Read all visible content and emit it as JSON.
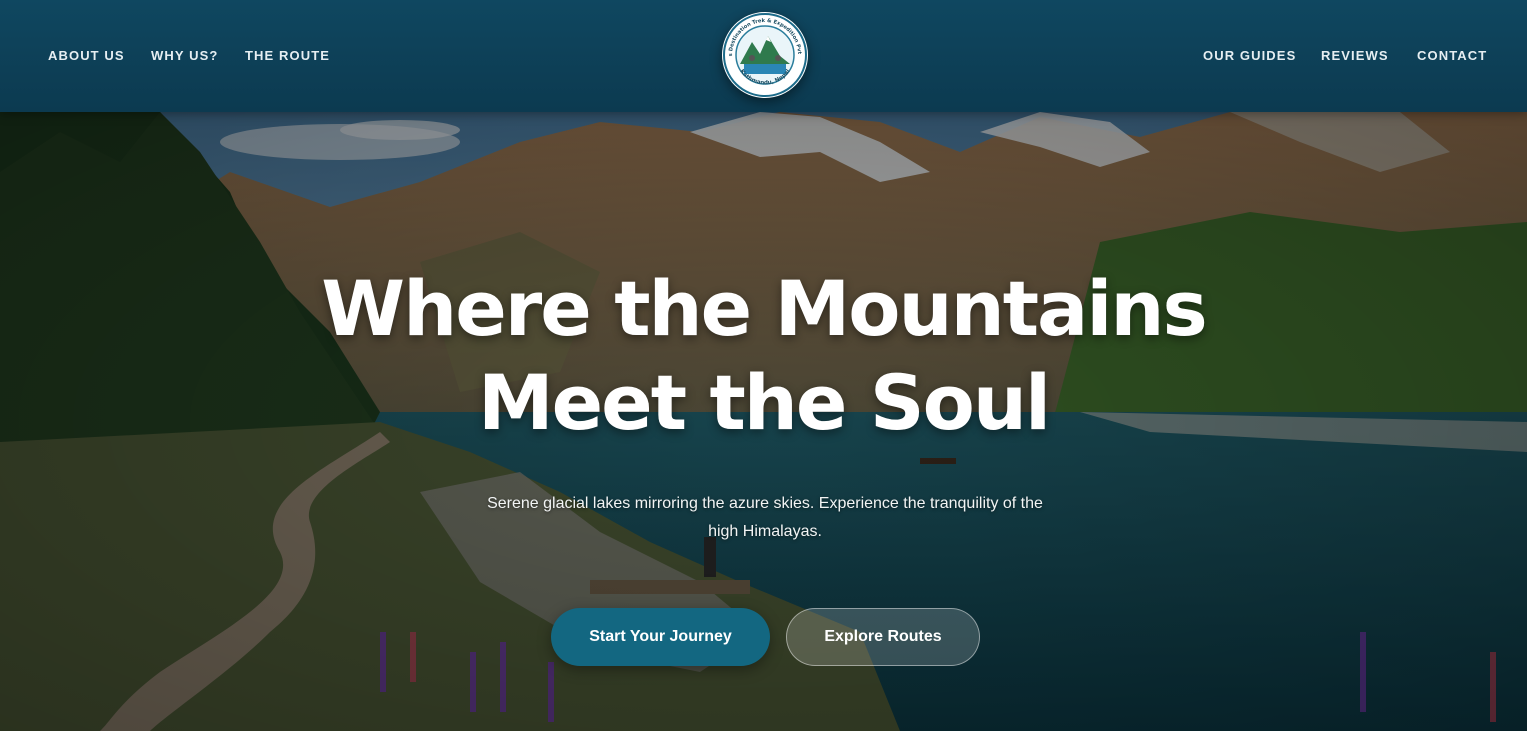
{
  "header": {
    "nav_left": [
      "ABOUT US",
      "WHY US?",
      "THE ROUTE"
    ],
    "nav_right": [
      "OUR GUIDES",
      "REVIEWS",
      "CONTACT"
    ],
    "logo": {
      "top_text": "Lotus Destination Trek & Expedition Pvt. Ltd.",
      "bottom_text": "Kathmandu, Nepal"
    }
  },
  "hero": {
    "title_line1": "Where the Mountains",
    "title_line2": "Meet the Soul",
    "subtitle": "Serene glacial lakes mirroring the azure skies. Experience the tranquility of the high Himalayas.",
    "primary_button": "Start Your Journey",
    "secondary_button": "Explore Routes"
  },
  "colors": {
    "header_bg": "#0f4760",
    "primary_button": "#136781",
    "text": "#ffffff"
  }
}
